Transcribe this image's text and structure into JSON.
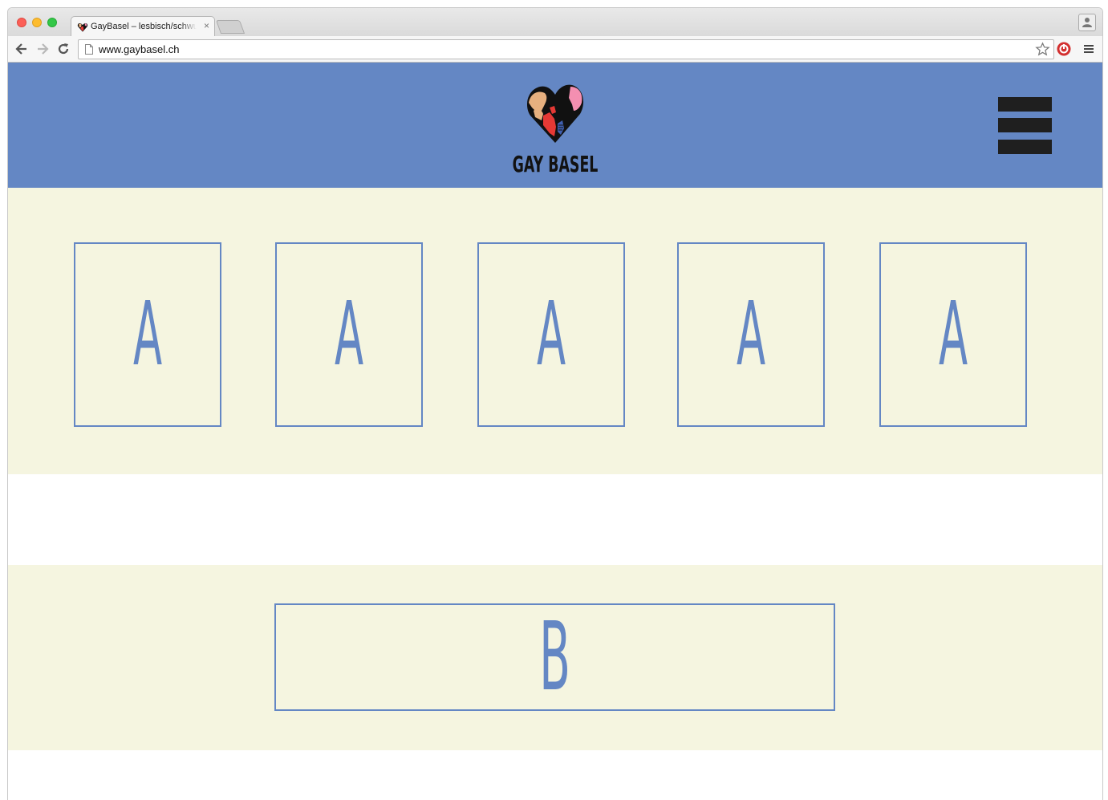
{
  "colors": {
    "brand": "#6487c4",
    "cream": "#f5f5e0"
  },
  "browser": {
    "tab": {
      "title": "GayBasel – lesbisch/schwul",
      "close_glyph": "×",
      "favicon": "heart-logo-icon"
    },
    "address_bar": {
      "url": "www.gaybasel.ch",
      "icon": "page-icon"
    },
    "toolbar_icons": [
      "back-arrow-icon",
      "forward-arrow-icon",
      "reload-icon",
      "star-icon",
      "extension-icon",
      "menu-icon",
      "profile-icon"
    ]
  },
  "site": {
    "logo_text": "GAY BASEL",
    "menu_icon": "hamburger-icon",
    "tiles_a": [
      {
        "label": "A"
      },
      {
        "label": "A"
      },
      {
        "label": "A"
      },
      {
        "label": "A"
      },
      {
        "label": "A"
      }
    ],
    "tile_b": {
      "label": "B"
    }
  }
}
